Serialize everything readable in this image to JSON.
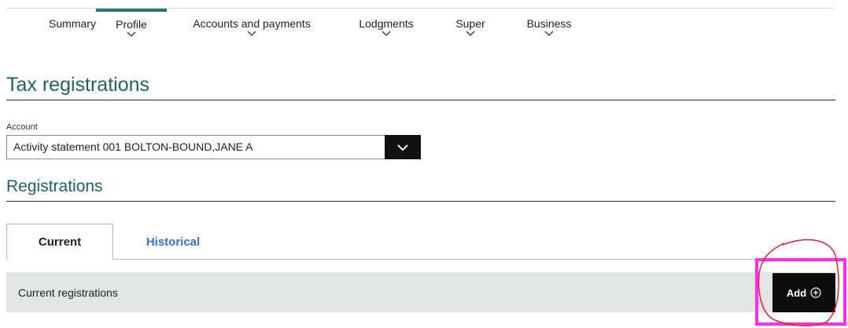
{
  "nav": {
    "items": [
      {
        "label": "Summary",
        "has_dropdown": false,
        "active": false
      },
      {
        "label": "Profile",
        "has_dropdown": true,
        "active": true
      },
      {
        "label": "Accounts and payments",
        "has_dropdown": true,
        "active": false
      },
      {
        "label": "Lodgments",
        "has_dropdown": true,
        "active": false
      },
      {
        "label": "Super",
        "has_dropdown": true,
        "active": false
      },
      {
        "label": "Business",
        "has_dropdown": true,
        "active": false
      }
    ]
  },
  "page": {
    "title": "Tax registrations"
  },
  "account": {
    "label": "Account",
    "selected": "Activity statement 001 BOLTON-BOUND,JANE A",
    "icon": "chevron-down-icon"
  },
  "registrations": {
    "title": "Registrations",
    "tabs": [
      {
        "label": "Current",
        "active": true
      },
      {
        "label": "Historical",
        "active": false
      }
    ],
    "bar_text": "Current registrations",
    "add_label": "Add",
    "add_icon": "plus-circle-icon"
  },
  "colors": {
    "accent": "#1f6263",
    "nav_active_bar": "#1f7a7a",
    "link": "#3b6fd1",
    "annotation": "#ff2cf0",
    "annotation_circle": "#e8202a"
  }
}
